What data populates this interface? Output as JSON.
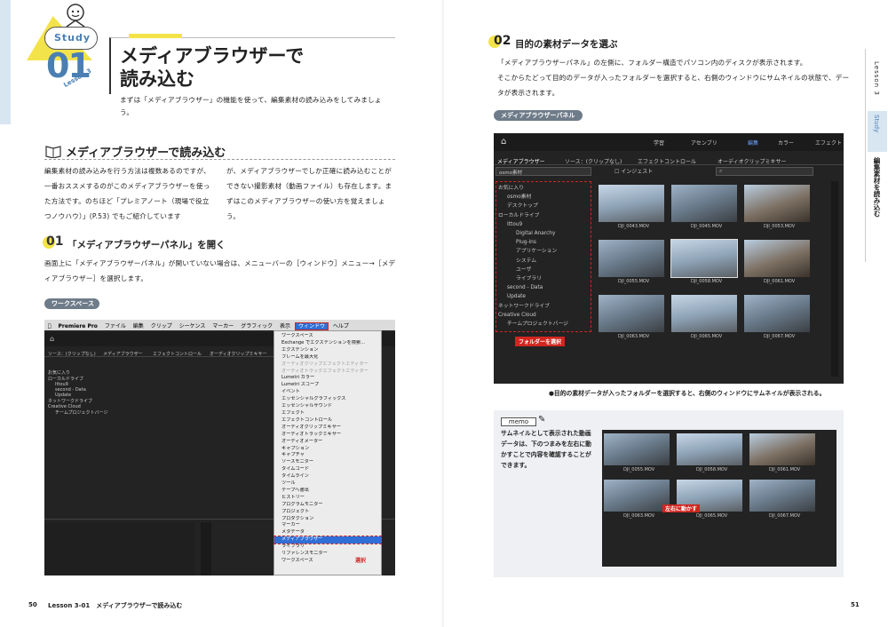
{
  "left_page": {
    "study_badge": "Study",
    "lesson_number": "01",
    "lesson_label": "Lesson 3",
    "title_line1": "メディアブラウザーで",
    "title_line2": "読み込む",
    "intro": "まずは「メディアブラウザー」の機能を使って、編集素材の読み込みをしてみましょう。",
    "section_heading": "メディアブラウザーで読み込む",
    "col1": "編集素材の読み込みを行う方法は複数あるのですが、一番おススメするのがこのメディアブラウザーを使った方法です。のちほど「プレミアノート（現場で役立つノウハウ）」(P.53) でもご紹介しています",
    "col2": "が、メディアブラウザーでしか正確に読み込むことができない撮影素材（動画ファイル）も存在します。まずはこのメディアブラウザーの使い方を覚えましょう。",
    "step1_num": "01",
    "step1_title": "「メディアブラウザーパネル」を開く",
    "step1_body": "画面上に「メディアブラウザーパネル」が開いていない場合は、メニューバーの［ウィンドウ］メニュー→［メディアブラウザー］を選択します。",
    "ws_label": "ワークスペース",
    "menubar": [
      "Premiere Pro",
      "ファイル",
      "編集",
      "クリップ",
      "シーケンス",
      "マーカー",
      "グラフィック",
      "表示",
      "ウィンドウ",
      "ヘルプ"
    ],
    "menu_items": [
      "ワークスペース",
      "Exchange でエクステンションを検索...",
      "エクステンション",
      "フレームを最大化",
      "オーディオクリップエフェクトエディター",
      "オーディオトラックエフェクトエディター",
      "Lumetri カラー",
      "Lumetri スコープ",
      "イベント",
      "エッセンシャルグラフィックス",
      "エッセンシャルサウンド",
      "エフェクト",
      "エフェクトコントロール",
      "オーディオクリップミキサー",
      "オーディオトラックミキサー",
      "オーディオメーター",
      "キャプション",
      "キャプチャ",
      "ソースモニター",
      "タイムコード",
      "タイムライン",
      "ツール",
      "テープへ書出",
      "ヒストリー",
      "プログラムモニター",
      "プロジェクト",
      "プロダクション",
      "マーカー",
      "メタデータ",
      "メディアブラウザー",
      "ライブラリ",
      "リファレンスモニター",
      "ワークスペース"
    ],
    "select_tag": "選択",
    "footer_page": "50",
    "footer_text": "Lesson 3-01　メディアブラウザーで読み込む"
  },
  "right_page": {
    "step2_num": "02",
    "step2_title": "目的の素材データを選ぶ",
    "step2_body1": "「メディアブラウザーパネル」の左側に、フォルダー構造でパソコン内のディスクが表示されます。",
    "step2_body2": "そこからたどって目的のデータが入ったフォルダーを選択すると、右側のウィンドウにサムネイルの状態で、データが表示されます。",
    "mb_label": "メディアブラウザーパネル",
    "tabs": [
      "メディアブラウザー",
      "ソース：(クリップなし)",
      "エフェクトコントロール",
      "オーディオクリップミキサー"
    ],
    "topbar": [
      "学習",
      "アセンブリ",
      "編集",
      "カラー",
      "エフェクト"
    ],
    "tree": [
      "お気に入り",
      "osmo素材",
      "デスクトップ",
      "ローカルドライブ",
      "Ittou9",
      "Digital Anarchy",
      "Plug-ins",
      "アプリケーション",
      "システム",
      "ユーザ",
      "ライブラリ",
      "second - Data",
      "Update",
      "ネットワークドライブ",
      "Creative Cloud",
      "チームプロジェクトバージ"
    ],
    "folder_tag": "フォルダーを選択",
    "thumbs": [
      "DJI_0043.MOV",
      "DJI_0045.MOV",
      "DJI_0053.MOV",
      "DJI_0055.MOV",
      "DJI_0058.MOV",
      "DJI_0061.MOV",
      "DJI_0063.MOV",
      "DJI_0065.MOV",
      "DJI_0067.MOV"
    ],
    "caption": "●目的の素材データが入ったフォルダーを選択すると、右側のウィンドウにサムネイルが表示される。",
    "memo_label": "memo",
    "memo_text": "サムネイルとして表示された動画データは、下のつまみを左右に動かすことで内容を確認することができます。",
    "drag_tag": "左右に動かす",
    "side_lesson": "Lesson 3",
    "side_study": "Study",
    "side_title": "編集素材を読み込む",
    "footer_page": "51"
  },
  "colors": {
    "accent_yellow": "#f3e34a",
    "accent_blue": "#d8e6f2",
    "panel_dark": "#232323",
    "select_red": "#d0261f",
    "menu_blue": "#2f6fd6"
  }
}
